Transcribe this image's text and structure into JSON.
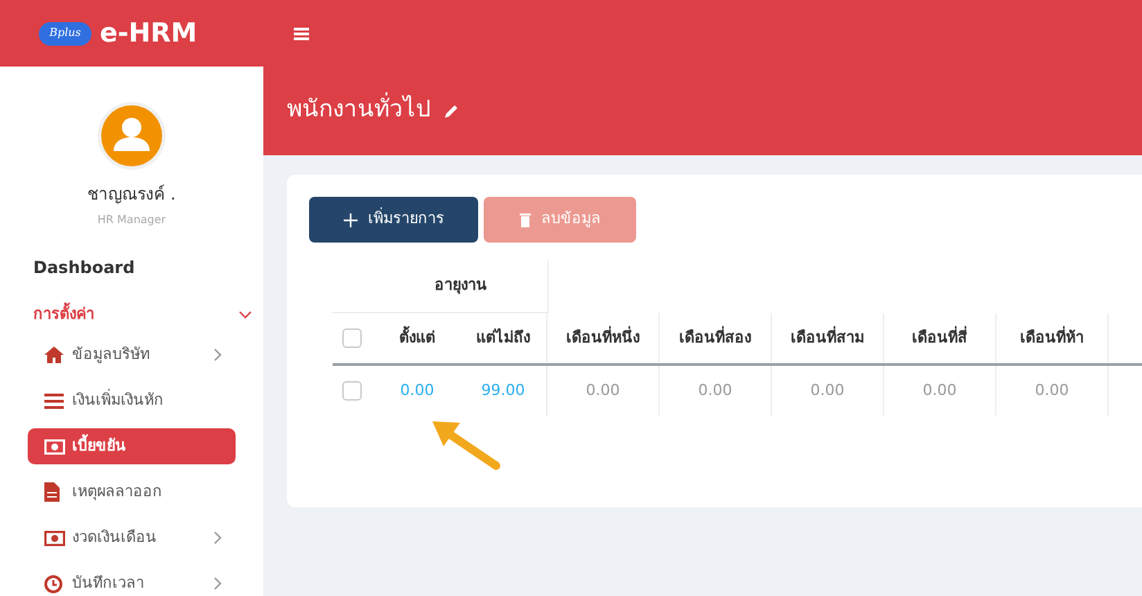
{
  "app": {
    "name": "e-HRM",
    "logo_text": "Bplus"
  },
  "user": {
    "name": "ชาญณรงค์ .",
    "role": "HR Manager"
  },
  "sidebar": {
    "items": [
      {
        "kind": "heading",
        "label": "Dashboard"
      },
      {
        "kind": "section",
        "label": "การตั้งค่า",
        "expanded": true,
        "children": [
          {
            "label": "ข้อมูลบริษัท",
            "kind": "home",
            "has_submenu": true,
            "selected": false
          },
          {
            "label": "เงินเพิ่มเงินหัก",
            "kind": "list",
            "has_submenu": false,
            "selected": false
          },
          {
            "label": "เบี้ยขยัน",
            "kind": "money",
            "has_submenu": false,
            "selected": true
          },
          {
            "label": "เหตุผลลาออก",
            "kind": "file",
            "has_submenu": false,
            "selected": false
          },
          {
            "label": "งวดเงินเดือน",
            "kind": "money",
            "has_submenu": true,
            "selected": false
          },
          {
            "label": "บันทึกเวลา",
            "kind": "clock",
            "has_submenu": true,
            "selected": false
          }
        ]
      }
    ]
  },
  "page": {
    "title": "พนักงานทั่วไป"
  },
  "buttons": [
    {
      "kind": "add",
      "label": "เพิ่มรายการ",
      "disabled": false
    },
    {
      "kind": "delete",
      "label": "ลบข้อมูล",
      "disabled": true
    }
  ],
  "table": {
    "group_header": "อายุงาน",
    "header_checked": false,
    "columns": [
      "ตั้งแต่",
      "แต่ไม่ถึง",
      "เดือนที่หนึ่ง",
      "เดือนที่สอง",
      "เดือนที่สาม",
      "เดือนที่สี่",
      "เดือนที่ห้า"
    ],
    "rows": [
      {
        "checked": false,
        "cells": [
          {
            "kind": "link",
            "text": "0.00"
          },
          {
            "kind": "link",
            "text": "99.00"
          },
          {
            "kind": "value",
            "text": "0.00"
          },
          {
            "kind": "value",
            "text": "0.00"
          },
          {
            "kind": "value",
            "text": "0.00"
          },
          {
            "kind": "value",
            "text": "0.00"
          },
          {
            "kind": "value",
            "text": "0.00"
          }
        ]
      }
    ]
  }
}
